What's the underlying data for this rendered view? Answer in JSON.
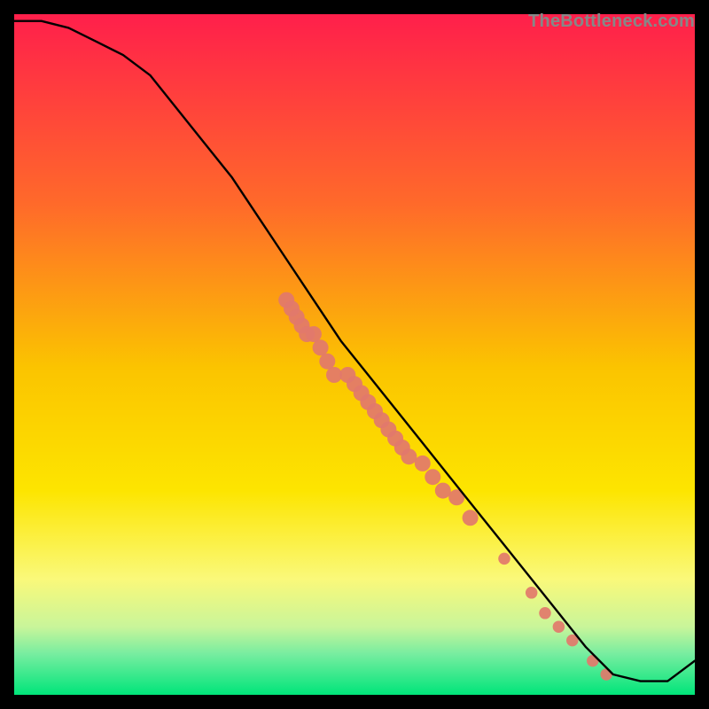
{
  "watermark": "TheBottleneck.com",
  "chart_data": {
    "type": "line",
    "title": "",
    "xlabel": "",
    "ylabel": "",
    "xlim": [
      0,
      100
    ],
    "ylim": [
      0,
      100
    ],
    "grid": false,
    "legend": false,
    "background_gradient": {
      "top_color": "#ff1f4b",
      "mid_color": "#fde500",
      "bottom_color": "#00e57a",
      "stops": [
        {
          "offset": 0.0,
          "color": "#ff1f4b"
        },
        {
          "offset": 0.28,
          "color": "#ff6a2a"
        },
        {
          "offset": 0.52,
          "color": "#fbc400"
        },
        {
          "offset": 0.7,
          "color": "#fde500"
        },
        {
          "offset": 0.83,
          "color": "#faf97a"
        },
        {
          "offset": 0.9,
          "color": "#c9f59a"
        },
        {
          "offset": 0.94,
          "color": "#77eda0"
        },
        {
          "offset": 1.0,
          "color": "#00e57a"
        }
      ]
    },
    "series": [
      {
        "name": "bottleneck-curve",
        "color": "#000000",
        "x": [
          0,
          4,
          8,
          12,
          16,
          20,
          24,
          28,
          32,
          36,
          40,
          44,
          48,
          52,
          56,
          60,
          64,
          68,
          72,
          76,
          80,
          84,
          88,
          92,
          96,
          100
        ],
        "y": [
          99,
          99,
          98,
          96,
          94,
          91,
          86,
          81,
          76,
          70,
          64,
          58,
          52,
          47,
          42,
          37,
          32,
          27,
          22,
          17,
          12,
          7,
          3,
          2,
          2,
          5
        ]
      }
    ],
    "markers": {
      "name": "highlight-points",
      "color": "#e2786b",
      "radius": 9,
      "clusters": [
        {
          "x_range": [
            40,
            43
          ],
          "y_range": [
            53,
            58
          ],
          "count": 5
        },
        {
          "x_range": [
            44,
            47
          ],
          "y_range": [
            47,
            53
          ],
          "count": 4
        },
        {
          "x_range": [
            49,
            58
          ],
          "y_range": [
            35,
            47
          ],
          "count": 10
        },
        {
          "x_range": [
            60,
            63
          ],
          "y_range": [
            30,
            34
          ],
          "count": 3
        },
        {
          "x_range": [
            65,
            67
          ],
          "y_range": [
            26,
            29
          ],
          "count": 2
        }
      ],
      "singletons": [
        {
          "x": 72,
          "y": 20
        },
        {
          "x": 76,
          "y": 15
        },
        {
          "x": 78,
          "y": 12
        },
        {
          "x": 80,
          "y": 10
        },
        {
          "x": 82,
          "y": 8
        },
        {
          "x": 85,
          "y": 5
        },
        {
          "x": 87,
          "y": 3
        }
      ]
    }
  }
}
